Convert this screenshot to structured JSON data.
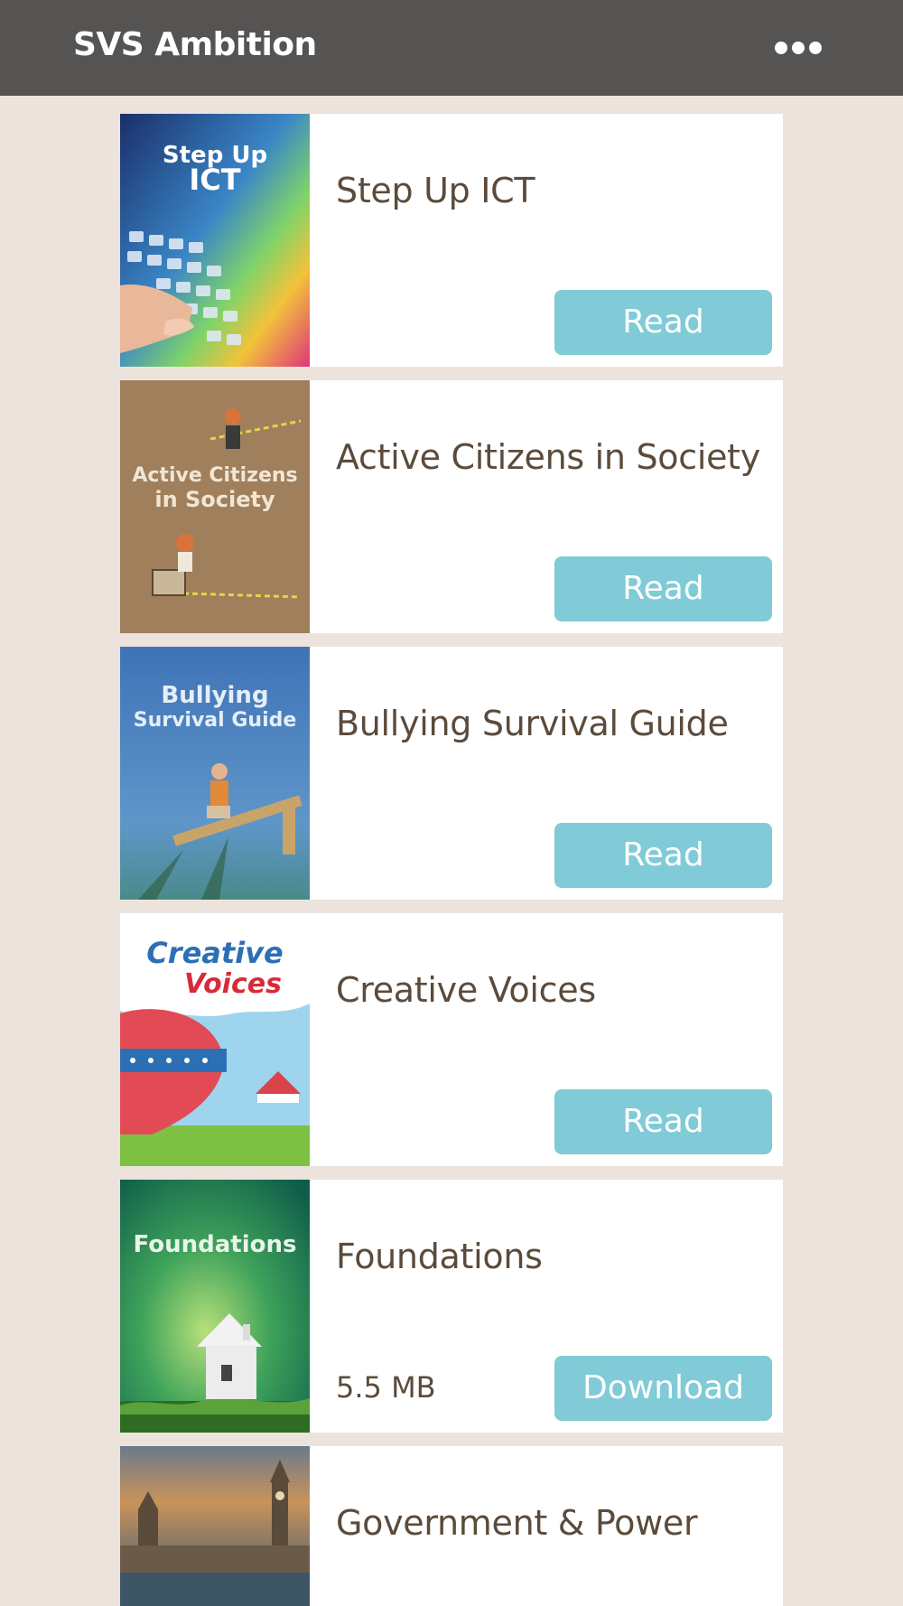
{
  "app": {
    "title": "SVS Ambition",
    "menu_icon": "more-horizontal-icon"
  },
  "books": [
    {
      "title": "Step Up ICT",
      "cover_text": [
        "Step Up",
        "ICT"
      ],
      "button_label": "Read",
      "cover_icon": "keyboard-cover-image"
    },
    {
      "title": "Active Citizens in Society",
      "cover_text": [
        "Active Citizens",
        "in Society"
      ],
      "button_label": "Read",
      "cover_icon": "citizens-cover-image"
    },
    {
      "title": "Bullying Survival Guide",
      "cover_text": [
        "Bullying",
        "Survival Guide"
      ],
      "button_label": "Read",
      "cover_icon": "seesaw-cover-image"
    },
    {
      "title": "Creative Voices",
      "cover_text": [
        "Creative",
        "Voices"
      ],
      "button_label": "Read",
      "cover_icon": "balloon-cover-image"
    },
    {
      "title": "Foundations",
      "cover_text": [
        "Foundations"
      ],
      "size": "5.5 MB",
      "button_label": "Download",
      "cover_icon": "house-cover-image"
    },
    {
      "title": "Government & Power",
      "cover_text": [],
      "cover_icon": "parliament-cover-image"
    }
  ],
  "colors": {
    "header_bg": "#555453",
    "page_bg": "#ece4dc",
    "button_bg": "#80cbd7",
    "title_text": "#5b4b3b"
  }
}
